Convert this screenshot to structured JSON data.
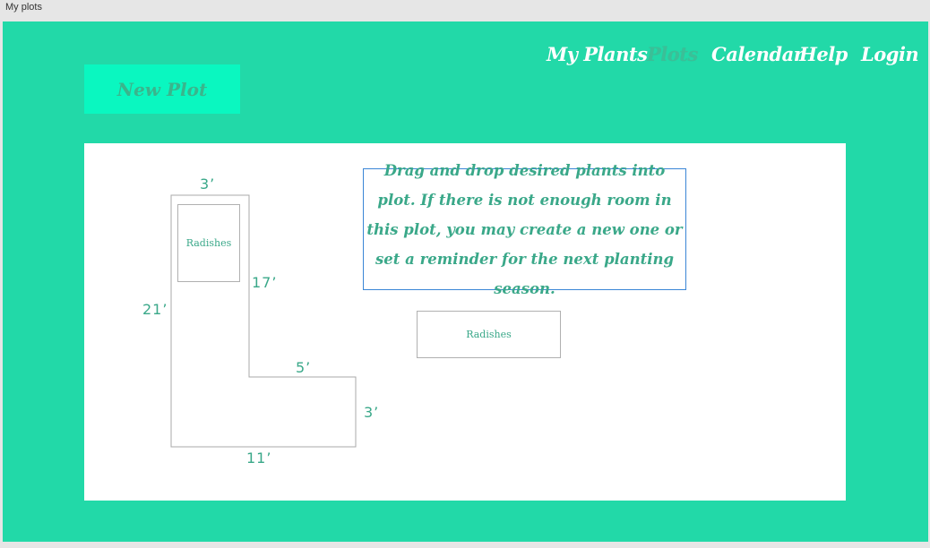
{
  "window": {
    "title": "My plots"
  },
  "nav": {
    "items": [
      {
        "label": "My Plants",
        "active": false
      },
      {
        "label": "Plots",
        "active": true
      },
      {
        "label": "Calendar",
        "active": false
      },
      {
        "label": "Help",
        "active": false
      },
      {
        "label": "Login",
        "active": false
      }
    ]
  },
  "new_plot_button": {
    "label": "New Plot"
  },
  "plot": {
    "dimensions": {
      "top_width": "3’",
      "left_height": "21’",
      "inner_vertical": "17’",
      "inner_horizontal": "5’",
      "right_height": "3’",
      "bottom_width": "11’"
    },
    "placed_plant": {
      "label": "Radishes"
    }
  },
  "instructions": {
    "text": "Drag and drop desired plants into plot. If there is not enough room in this plot, you may create a new one or set a reminder for the next planting season."
  },
  "palette_plant": {
    "label": "Radishes"
  },
  "colors": {
    "app_background": "#22d9a8",
    "button_background": "#0af7c0",
    "accent_text": "#3aa889",
    "instruction_border": "#3a86d6"
  }
}
